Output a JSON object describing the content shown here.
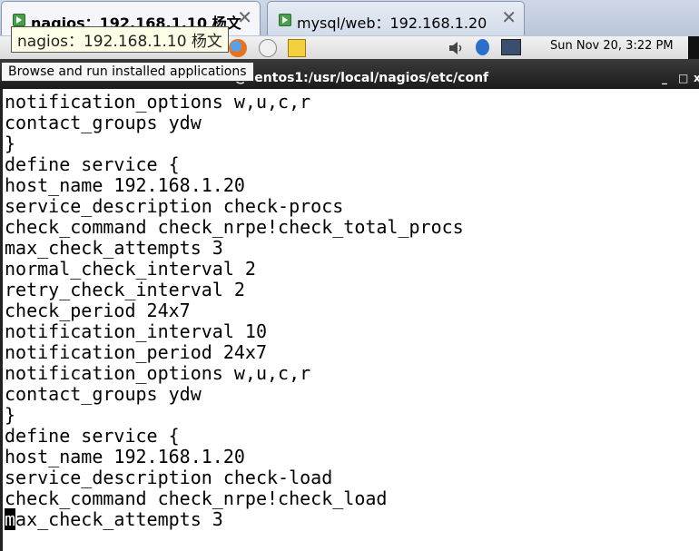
{
  "browser": {
    "tabs": [
      {
        "title": "nagios：192.168.1.10 杨文",
        "close": "✕"
      },
      {
        "title": "mysql/web：192.168.1.20",
        "close": "✕"
      }
    ],
    "tooltip": "nagios：192.168.1.10 杨文"
  },
  "panel": {
    "tooltip": "Browse and run installed applications",
    "clock": "Sun Nov 20,  3:22 PM",
    "icons": [
      "firefox-icon",
      "mail-icon",
      "notes-icon",
      "volume-icon",
      "bluetooth-icon",
      "network-icon"
    ]
  },
  "window": {
    "title": "@centos1:/usr/local/nagios/etc/conf",
    "min": "_",
    "max": "□",
    "close": "x"
  },
  "terminal": {
    "lines": [
      "notification_options w,u,c,r",
      "contact_groups ydw",
      "}",
      "define service {",
      "host_name 192.168.1.20",
      "service_description check-procs",
      "check_command check_nrpe!check_total_procs",
      "max_check_attempts 3",
      "normal_check_interval 2",
      "retry_check_interval 2",
      "check_period 24x7",
      "notification_interval 10",
      "notification_period 24x7",
      "notification_options w,u,c,r",
      "contact_groups ydw",
      "}",
      "define service {",
      "host_name 192.168.1.20",
      "service_description check-load",
      "check_command check_nrpe!check_load"
    ],
    "cursor_char": "m",
    "cursor_line_rest": "ax_check_attempts 3"
  }
}
